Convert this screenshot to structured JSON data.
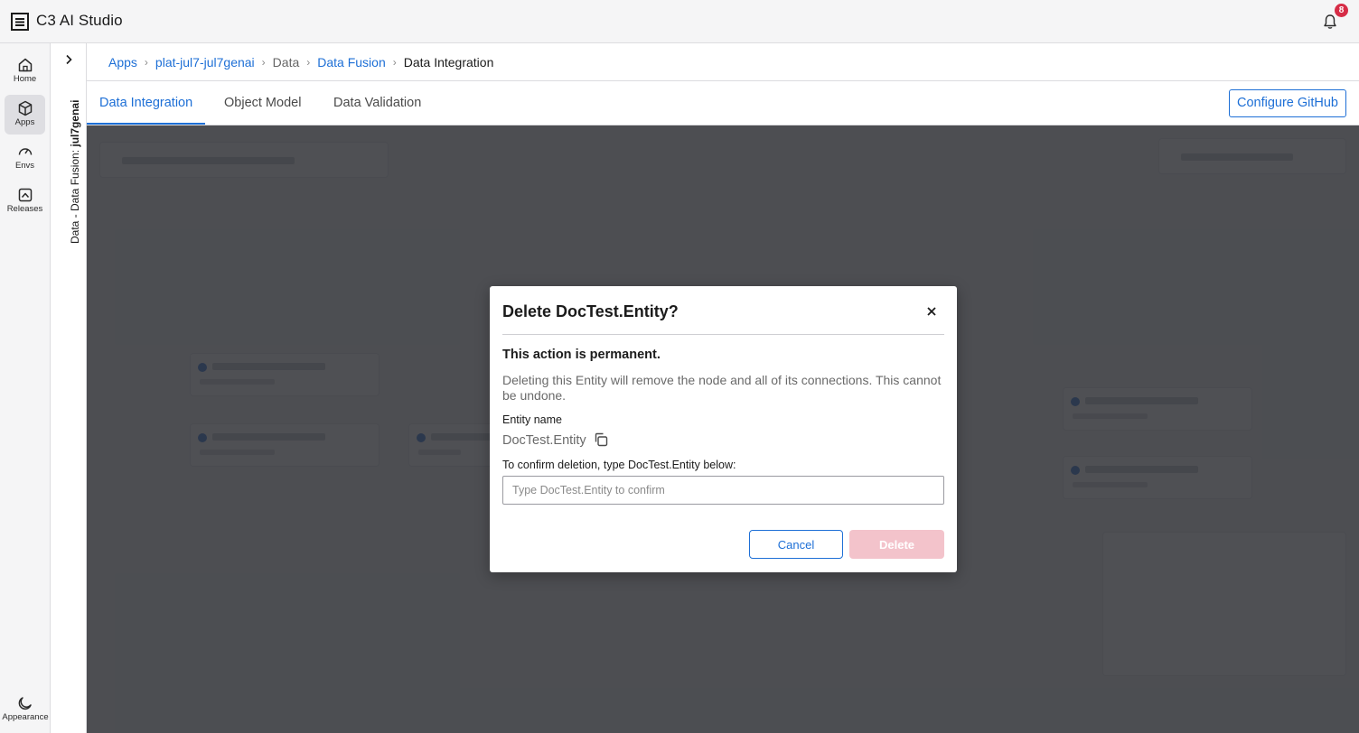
{
  "app": {
    "title": "C3 AI Studio",
    "notifications_count": "8"
  },
  "rail": {
    "items": [
      {
        "label": "Home",
        "icon": "home-icon"
      },
      {
        "label": "Apps",
        "icon": "cube-icon",
        "active": true
      },
      {
        "label": "Envs",
        "icon": "gauge-icon"
      },
      {
        "label": "Releases",
        "icon": "release-icon"
      }
    ],
    "bottom": {
      "label": "Appearance",
      "icon": "moon-icon"
    }
  },
  "context": {
    "prefix": "Data - Data Fusion:",
    "name": "jul7genai"
  },
  "breadcrumb": {
    "items": [
      "Apps",
      "plat-jul7-jul7genai",
      "Data",
      "Data Fusion",
      "Data Integration"
    ]
  },
  "tabs": {
    "items": [
      "Data Integration",
      "Object Model",
      "Data Validation"
    ],
    "active": "Data Integration",
    "configure_github": "Configure GitHub"
  },
  "dialog": {
    "title": "Delete DocTest.Entity?",
    "warning": "This action is permanent.",
    "description": "Deleting this Entity will remove the node and all of its connections. This cannot be undone.",
    "entity_label": "Entity name",
    "entity_value": "DocTest.Entity",
    "confirm_label": "To confirm deletion, type DocTest.Entity below:",
    "confirm_placeholder": "Type DocTest.Entity to confirm",
    "cancel_label": "Cancel",
    "delete_label": "Delete"
  },
  "colors": {
    "accent": "#1d6fd6",
    "badge": "#d62c46",
    "delete_disabled": "#f3c3cb"
  }
}
